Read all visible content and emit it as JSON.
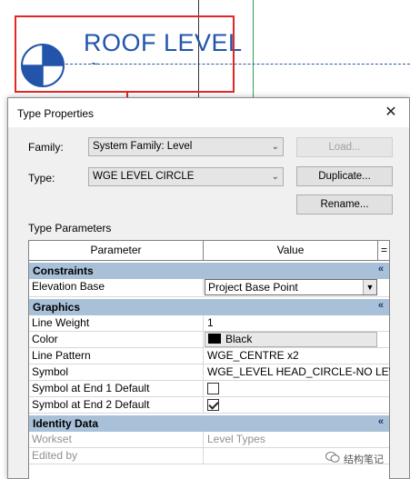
{
  "drawing": {
    "level_name": "ROOF LEVEL",
    "line_break_symbol": "~"
  },
  "dialog": {
    "title": "Type Properties",
    "close_icon": "close-icon",
    "family_label": "Family:",
    "family_value": "System Family: Level",
    "type_label": "Type:",
    "type_value": "WGE LEVEL CIRCLE",
    "load_button": "Load...",
    "duplicate_button": "Duplicate...",
    "rename_button": "Rename...",
    "type_parameters_label": "Type Parameters"
  },
  "grid": {
    "col_parameter": "Parameter",
    "col_value": "Value",
    "col_sort": "=",
    "groups": {
      "constraints": "Constraints",
      "graphics": "Graphics",
      "identity": "Identity Data"
    },
    "rows": {
      "elevation_base": {
        "param": "Elevation Base",
        "value": "Project Base Point"
      },
      "line_weight": {
        "param": "Line Weight",
        "value": "1"
      },
      "color": {
        "param": "Color",
        "value": "Black"
      },
      "line_pattern": {
        "param": "Line Pattern",
        "value": "WGE_CENTRE x2"
      },
      "symbol": {
        "param": "Symbol",
        "value": "WGE_LEVEL HEAD_CIRCLE-NO LEVE"
      },
      "symbol_end1": {
        "param": "Symbol at End 1 Default",
        "checked": false
      },
      "symbol_end2": {
        "param": "Symbol at End 2 Default",
        "checked": true
      },
      "workset": {
        "param": "Workset",
        "value": "Level Types"
      },
      "edited_by": {
        "param": "Edited by",
        "value": ""
      }
    },
    "collapse_glyph": "«"
  },
  "watermark": {
    "text": "结构笔记"
  },
  "colors": {
    "level_blue": "#2255aa",
    "highlight_red": "#e32626",
    "group_header": "#a8c0d8"
  }
}
